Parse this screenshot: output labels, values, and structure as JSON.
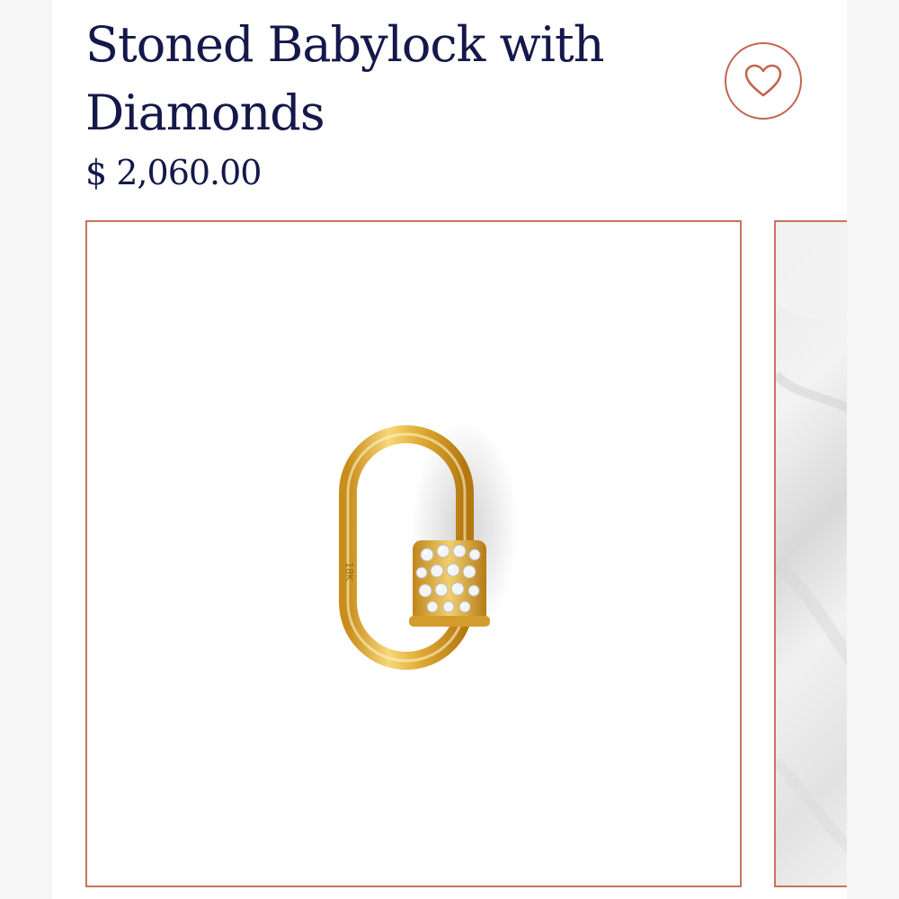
{
  "product": {
    "title": "Stoned Babylock with Diamonds",
    "price": "$ 2,060.00"
  },
  "wishlist": {
    "icon": "heart-icon"
  },
  "gallery": {
    "main_image": "gold-diamond-lock-image",
    "next_image": "white-fabric-image"
  },
  "colors": {
    "title_text": "#14184a",
    "accent_border": "#c8735d",
    "gold": "#e3b23c"
  }
}
